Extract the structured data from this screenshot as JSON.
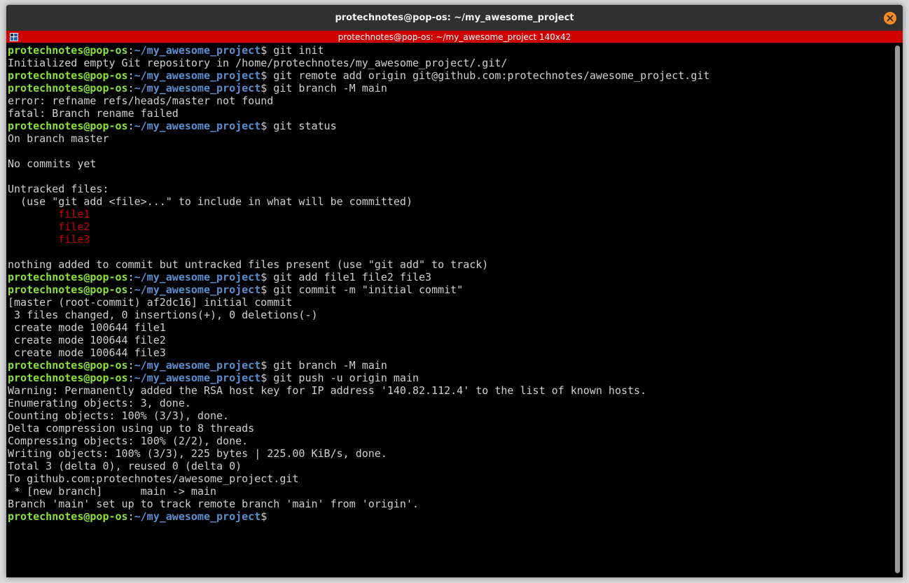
{
  "window": {
    "title": "protechnotes@pop-os: ~/my_awesome_project"
  },
  "tab": {
    "label": "protechnotes@pop-os: ~/my_awesome_project 140x42",
    "color": "#d10000"
  },
  "colors": {
    "prompt_user": "#8ae234",
    "prompt_path": "#5a8fd0",
    "untracked_file": "#cc0000",
    "close_button": "#fb8b1e"
  },
  "prompt": {
    "user_host": "protechnotes@pop-os",
    "path": "~/my_awesome_project",
    "symbol": "$"
  },
  "terminal": {
    "lines": [
      {
        "type": "prompt",
        "command": " git init"
      },
      {
        "type": "output",
        "text": "Initialized empty Git repository in /home/protechnotes/my_awesome_project/.git/"
      },
      {
        "type": "prompt",
        "command": " git remote add origin git@github.com:protechnotes/awesome_project.git"
      },
      {
        "type": "prompt",
        "command": " git branch -M main"
      },
      {
        "type": "output",
        "text": "error: refname refs/heads/master not found"
      },
      {
        "type": "output",
        "text": "fatal: Branch rename failed"
      },
      {
        "type": "prompt",
        "command": " git status"
      },
      {
        "type": "output",
        "text": "On branch master"
      },
      {
        "type": "output",
        "text": ""
      },
      {
        "type": "output",
        "text": "No commits yet"
      },
      {
        "type": "output",
        "text": ""
      },
      {
        "type": "output",
        "text": "Untracked files:"
      },
      {
        "type": "output",
        "text": "  (use \"git add <file>...\" to include in what will be committed)"
      },
      {
        "type": "red",
        "text": "        file1"
      },
      {
        "type": "red",
        "text": "        file2"
      },
      {
        "type": "red",
        "text": "        file3"
      },
      {
        "type": "output",
        "text": ""
      },
      {
        "type": "output",
        "text": "nothing added to commit but untracked files present (use \"git add\" to track)"
      },
      {
        "type": "prompt",
        "command": " git add file1 file2 file3"
      },
      {
        "type": "prompt",
        "command": " git commit -m \"initial commit\""
      },
      {
        "type": "output",
        "text": "[master (root-commit) af2dc16] initial commit"
      },
      {
        "type": "output",
        "text": " 3 files changed, 0 insertions(+), 0 deletions(-)"
      },
      {
        "type": "output",
        "text": " create mode 100644 file1"
      },
      {
        "type": "output",
        "text": " create mode 100644 file2"
      },
      {
        "type": "output",
        "text": " create mode 100644 file3"
      },
      {
        "type": "prompt",
        "command": " git branch -M main"
      },
      {
        "type": "prompt",
        "command": " git push -u origin main"
      },
      {
        "type": "output",
        "text": "Warning: Permanently added the RSA host key for IP address '140.82.112.4' to the list of known hosts."
      },
      {
        "type": "output",
        "text": "Enumerating objects: 3, done."
      },
      {
        "type": "output",
        "text": "Counting objects: 100% (3/3), done."
      },
      {
        "type": "output",
        "text": "Delta compression using up to 8 threads"
      },
      {
        "type": "output",
        "text": "Compressing objects: 100% (2/2), done."
      },
      {
        "type": "output",
        "text": "Writing objects: 100% (3/3), 225 bytes | 225.00 KiB/s, done."
      },
      {
        "type": "output",
        "text": "Total 3 (delta 0), reused 0 (delta 0)"
      },
      {
        "type": "output",
        "text": "To github.com:protechnotes/awesome_project.git"
      },
      {
        "type": "output",
        "text": " * [new branch]      main -> main"
      },
      {
        "type": "output",
        "text": "Branch 'main' set up to track remote branch 'main' from 'origin'."
      },
      {
        "type": "prompt",
        "command": ""
      }
    ]
  }
}
